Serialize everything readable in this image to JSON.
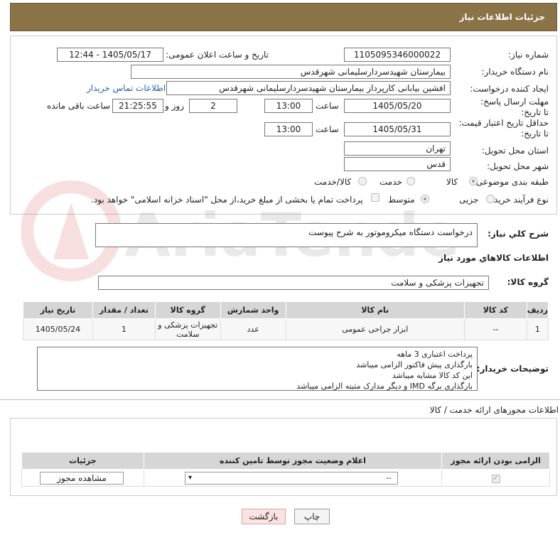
{
  "header": {
    "title": "جزئیات اطلاعات نیاز"
  },
  "form": {
    "need_number_label": "شماره نیاز:",
    "need_number": "1105095346000022",
    "announce_label": "تاریخ و ساعت اعلان عمومی:",
    "announce_value": "1405/05/17 - 12:44",
    "buyer_org_label": "نام دستگاه خریدار:",
    "buyer_org": "بیمارستان شهیدسردارسلیمانی شهرقدس",
    "requester_label": "ایجاد کننده درخواست:",
    "requester": "افشین بیابانی کارپرداز بیمارستان شهیدسردارسلیمانی شهرقدس",
    "buyer_contact_link": "اطلاعات تماس خریدار",
    "deadline_label": "مهلت ارسال پاسخ: تا تاریخ:",
    "deadline_date": "1405/05/20",
    "hour_label": "ساعت",
    "deadline_time": "13:00",
    "days_value": "2",
    "days_label": "روز و",
    "remaining_time": "21:25:55",
    "remaining_label": "ساعت باقی مانده",
    "price_valid_label": "حداقل تاریخ اعتبار قیمت: تا تاریخ:",
    "price_valid_date": "1405/05/31",
    "price_valid_time": "13:00",
    "province_label": "استان محل تحویل:",
    "province": "تهران",
    "city_label": "شهر محل تحویل:",
    "city": "قدس",
    "category_label": "طبقه بندی موضوعی:",
    "category_options": [
      "کالا",
      "خدمت",
      "کالا/خدمت"
    ],
    "purchase_type_label": "نوع فرآیند خرید :",
    "purchase_options": [
      "جزیی",
      "متوسط"
    ],
    "payment_note": "پرداخت تمام یا بخشی از مبلغ خرید،از محل \"اسناد خزانه اسلامی\" خواهد بود."
  },
  "description": {
    "label": "شرح کلي نياز:",
    "text": "درخواست دستگاه میکروموتور به شرح پیوست"
  },
  "goods": {
    "section_title": "اطلاعات کالاهاي مورد نياز",
    "group_label": "گروه کالا:",
    "group_value": "تجهیزات پزشکی و سلامت",
    "columns": [
      "ردیف",
      "کد کالا",
      "نام کالا",
      "واحد شمارش",
      "گروه کالا",
      "تعداد / مقدار",
      "تاریخ نیاز"
    ],
    "rows": [
      [
        "1",
        "--",
        "ابزار جراحی عمومی",
        "عدد",
        "تجهیزات پزشکی و سلامت",
        "1",
        "1405/05/24"
      ]
    ]
  },
  "buyer_notes": {
    "label": "توضیحات خریدار:",
    "lines": [
      "پرداخت اعتباری 3 ماهه",
      "بارگذاری پیش فاکتور الزامی میباشد",
      "این کد کالا مشابه میباشد",
      "بارگذاری برگه IMD و دیگر مدارک مثبته الزامی میباشد"
    ]
  },
  "licenses": {
    "title": "اطلاعات مجوزهای ارائه خدمت / کالا",
    "columns": [
      "الزامی بودن ارائه مجوز",
      "اعلام وضعیت مجوز توسط تامین کننده",
      "جزئیات"
    ],
    "select_value": "--",
    "view_button": "مشاهده مجوز"
  },
  "footer": {
    "print_button": "چاپ",
    "back_button": "بازگشت"
  }
}
